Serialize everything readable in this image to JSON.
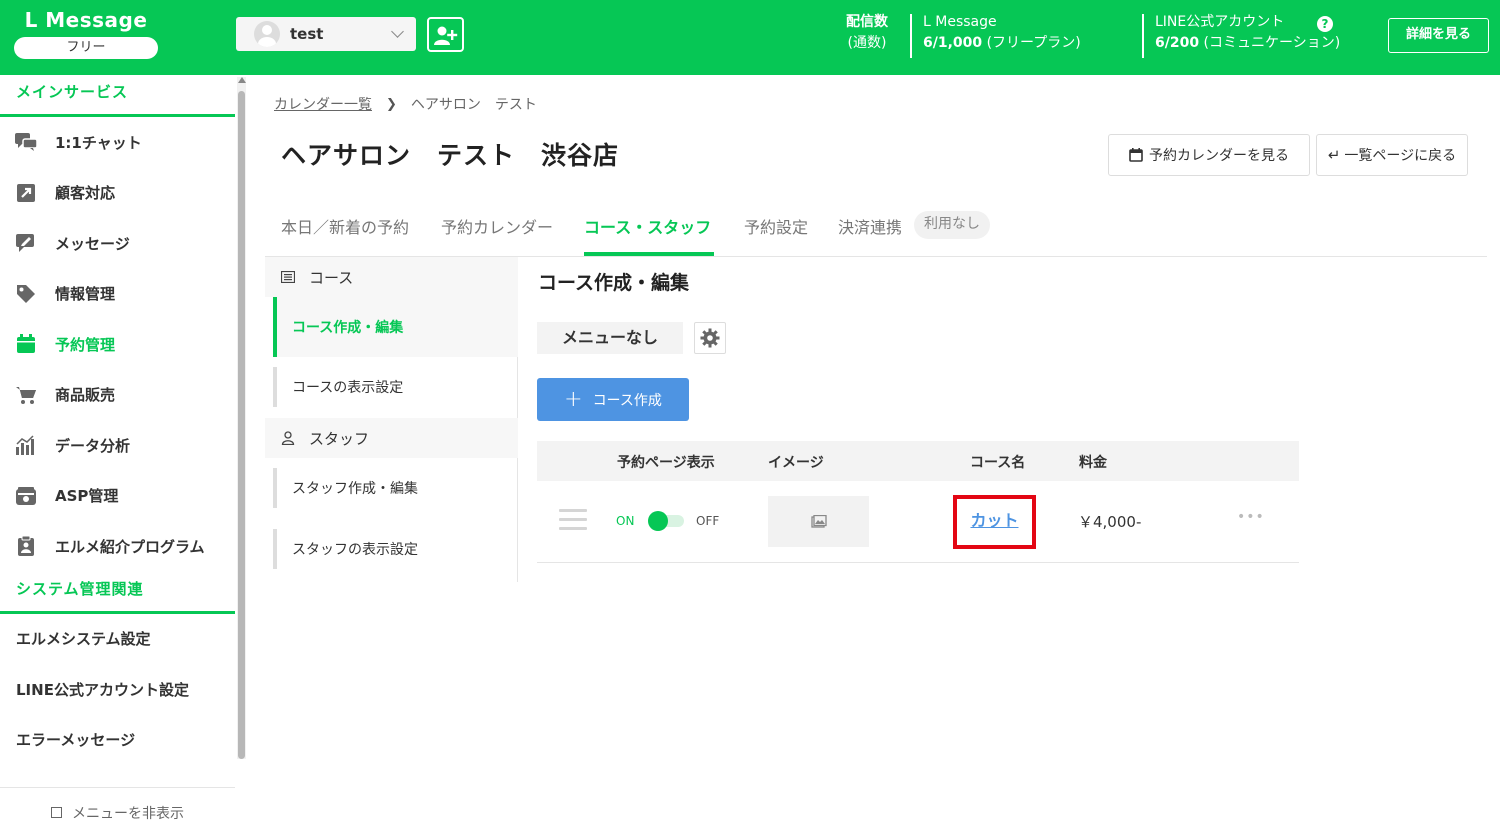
{
  "header": {
    "logo": "L Message",
    "plan": "フリー",
    "account": "test",
    "delivery_label": "配信数",
    "delivery_sub": "(通数)",
    "lm_label": "L Message",
    "lm_value_bold": "6/1,000",
    "lm_value_rest": " (フリープラン)",
    "line_label": "LINE公式アカウント",
    "line_value_bold": "6/200",
    "line_value_rest": " (コミュニケーション)",
    "help": "?",
    "detail_button": "詳細を見る"
  },
  "sidebar": {
    "section_main": "メインサービス",
    "items": [
      {
        "label": "1:1チャット",
        "icon": "chat-icon"
      },
      {
        "label": "顧客対応",
        "icon": "arrow-out-icon"
      },
      {
        "label": "メッセージ",
        "icon": "message-edit-icon"
      },
      {
        "label": "情報管理",
        "icon": "tag-icon"
      },
      {
        "label": "予約管理",
        "icon": "calendar-icon"
      },
      {
        "label": "商品販売",
        "icon": "cart-icon"
      },
      {
        "label": "データ分析",
        "icon": "chart-icon"
      },
      {
        "label": "ASP管理",
        "icon": "asp-icon"
      },
      {
        "label": "エルメ紹介プログラム",
        "icon": "clipboard-user-icon"
      }
    ],
    "section_system": "システム管理関連",
    "system_items": [
      "エルメシステム設定",
      "LINE公式アカウント設定",
      "エラーメッセージ"
    ],
    "hide_menu": "メニューを非表示"
  },
  "breadcrumb": {
    "link": "カレンダー一覧",
    "current": "ヘアサロン　テスト"
  },
  "page_title": "ヘアサロン　テスト　渋谷店",
  "actions": {
    "calendar": "予約カレンダーを見る",
    "back": "一覧ページに戻る"
  },
  "tabs": [
    "本日／新着の予約",
    "予約カレンダー",
    "コース・スタッフ",
    "予約設定",
    "決済連携"
  ],
  "tab_badge": "利用なし",
  "subnav": {
    "course_head": "コース",
    "course_edit": "コース作成・編集",
    "course_display": "コースの表示設定",
    "staff_head": "スタッフ",
    "staff_edit": "スタッフ作成・編集",
    "staff_display": "スタッフの表示設定"
  },
  "content": {
    "title": "コース作成・編集",
    "menu_chip": "メニューなし",
    "create_button": "コース作成",
    "columns": [
      "予約ページ表示",
      "イメージ",
      "コース名",
      "料金"
    ],
    "rows": [
      {
        "on": "ON",
        "off": "OFF",
        "name": "カット",
        "price": "￥4,000-",
        "more": "•••"
      }
    ]
  }
}
